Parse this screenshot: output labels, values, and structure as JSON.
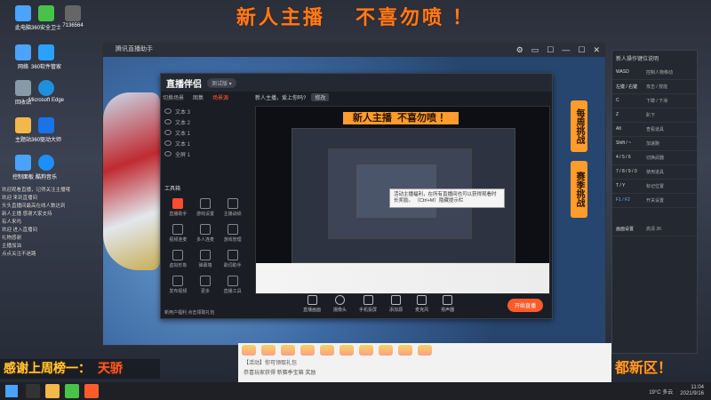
{
  "banner": {
    "left": "新人主播",
    "right": "不喜勿喷 ！"
  },
  "desktop_icons": [
    {
      "label": "此电脑",
      "color": "#4aa3ff"
    },
    {
      "label": "360安全卫士",
      "color": "#48c34a"
    },
    {
      "label": "7136564",
      "color": "#666"
    },
    {
      "label": "网络",
      "color": "#4aa3ff"
    },
    {
      "label": "360软件管家",
      "color": "#2aa1ff"
    },
    {
      "label": "回收站",
      "color": "#8899aa"
    },
    {
      "label": "Microsoft Edge",
      "color": "#1f8fe0"
    },
    {
      "label": "主题站",
      "color": "#f2b84a"
    },
    {
      "label": "360驱动大师",
      "color": "#1a73e8"
    },
    {
      "label": "控制面板",
      "color": "#4aa3ff"
    },
    {
      "label": "酷狗音乐",
      "color": "#1d8ffa"
    }
  ],
  "live_window": {
    "title": "腾讯直播助手",
    "controls": [
      "⚙",
      "▭",
      "☐",
      "—",
      "☐",
      "✕"
    ]
  },
  "companion": {
    "logo": "直播伴侣",
    "version": "测试版 ▾",
    "tabs": [
      "切换场景",
      "图集",
      "场景源"
    ],
    "active_tab": 2,
    "room_title": "新人主播，爱上你吗?",
    "room_badge": "修改",
    "sources": [
      "文本 3",
      "文本 2",
      "文本 1",
      "文本 1",
      "全屏 1"
    ],
    "tools_title": "工具箱",
    "tools": [
      "直播助手",
      "游戏设置",
      "主播战绩",
      "视频连麦",
      "多人连麦",
      "游戏管理",
      "虚拟形象",
      "弹幕墙",
      "歌词助手",
      "发布视频",
      "更多",
      "直播工具"
    ],
    "controls": [
      "直播画面",
      "摄像头",
      "手机投屏",
      "添加源",
      "麦克风",
      "扬声器"
    ],
    "start_button": "开始直播",
    "popup_text": "活动主播福利，在所有直播间也可以获得观看时长奖励。\n（Ctrl+M）隐藏提示栏",
    "bottom_hint": "新用户福利 点击领取礼包"
  },
  "side_badges": [
    "每周挑战",
    "赛季挑战"
  ],
  "hotkeys": {
    "title": "新人操作键位说明",
    "rows": [
      {
        "key": "WASD",
        "desc": "控制人物移动"
      },
      {
        "key": "左键 / 右键",
        "desc": "攻击 / 技能"
      },
      {
        "key": "C",
        "desc": "下蹲 / 下滑"
      },
      {
        "key": "Z",
        "desc": "趴下"
      },
      {
        "key": "Alt",
        "desc": "查看道具"
      },
      {
        "key": "Shift / ~",
        "desc": "加速跑"
      },
      {
        "key": "4 / 5 / 6",
        "desc": "切换武器"
      },
      {
        "key": "7 / 8 / 9 / 0",
        "desc": "使用道具"
      },
      {
        "key": "T / Y",
        "desc": "标记位置"
      },
      {
        "key": "F1 / F2",
        "desc": "开关设置"
      }
    ],
    "footer_label": "画面设置",
    "footer_text": "高清 2K"
  },
  "chat": [
    "欢迎观看直播，记得关注主播哦",
    "欢迎 来到直播间",
    "头头直播间最高在线人数达到",
    "新人主播 感谢大家支持",
    "有人来吗",
    "欢迎 进入直播间",
    "礼物感谢",
    "主播加油",
    "点点关注不迷路"
  ],
  "marquee_left": {
    "text": "感谢上周榜一：",
    "hot": "天骄"
  },
  "marquee_right": "新赛季，都新区！",
  "browser": {
    "line1": "【活动】你可领取礼包",
    "line2": "恭喜玩家获得 新赛季宝箱 奖励"
  },
  "taskbar": {
    "weather": "19°C 多云",
    "time": "11:04",
    "date": "2021/9/16"
  }
}
